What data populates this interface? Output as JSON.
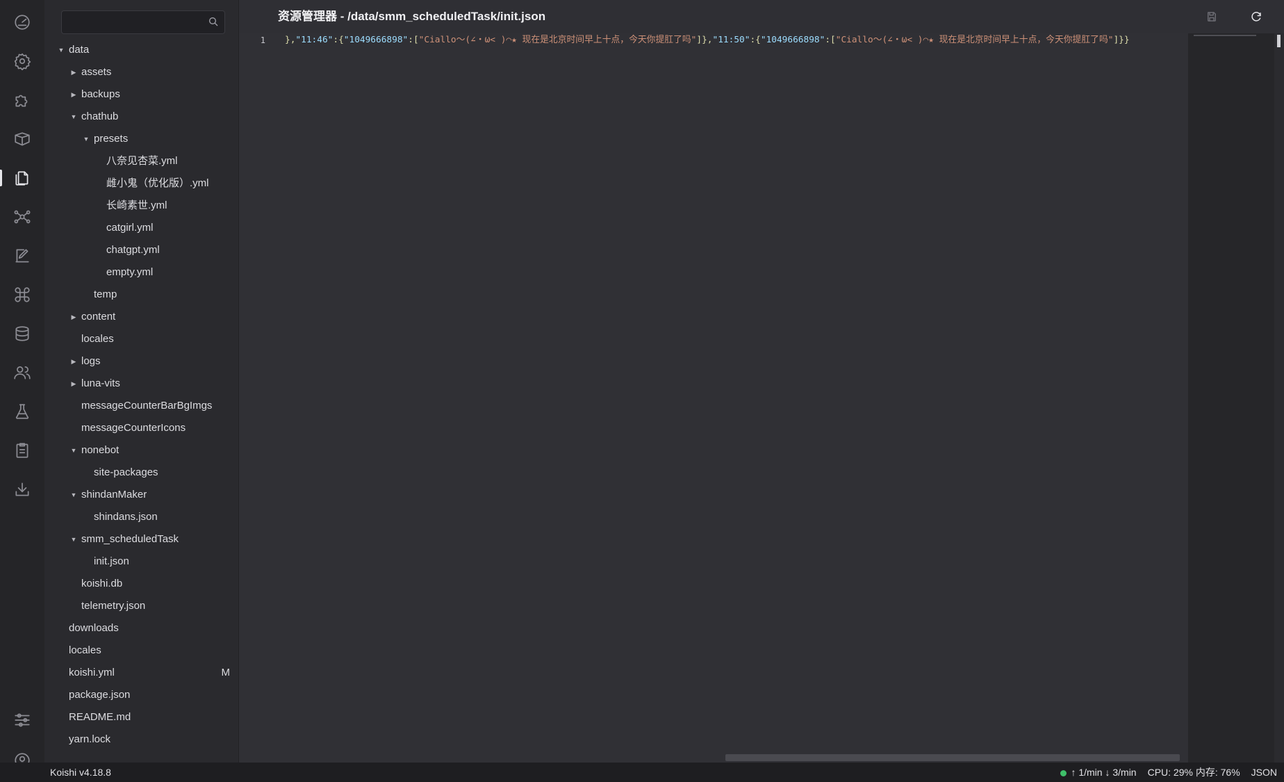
{
  "app": {
    "version": "Koishi v4.18.8"
  },
  "activity_bar": {
    "items": [
      {
        "name": "dashboard-icon"
      },
      {
        "name": "settings-icon"
      },
      {
        "name": "plugin-icon"
      },
      {
        "name": "market-icon"
      },
      {
        "name": "files-icon",
        "active": true
      },
      {
        "name": "graph-icon"
      },
      {
        "name": "edit-icon"
      },
      {
        "name": "command-icon"
      },
      {
        "name": "database-icon"
      },
      {
        "name": "users-icon"
      },
      {
        "name": "sandbox-icon"
      },
      {
        "name": "logs-icon"
      },
      {
        "name": "download-icon"
      },
      {
        "name": "sliders-icon"
      },
      {
        "name": "account-icon"
      }
    ]
  },
  "sidebar": {
    "search": {
      "placeholder": "",
      "value": ""
    },
    "tree": [
      {
        "label": "data",
        "depth": 0,
        "expanded": true,
        "folder": true
      },
      {
        "label": "assets",
        "depth": 1,
        "expanded": false,
        "folder": true
      },
      {
        "label": "backups",
        "depth": 1,
        "expanded": false,
        "folder": true
      },
      {
        "label": "chathub",
        "depth": 1,
        "expanded": true,
        "folder": true
      },
      {
        "label": "presets",
        "depth": 2,
        "expanded": true,
        "folder": true
      },
      {
        "label": "八奈见杏菜.yml",
        "depth": 3
      },
      {
        "label": "雌小鬼（优化版）.yml",
        "depth": 3
      },
      {
        "label": "长崎素世.yml",
        "depth": 3
      },
      {
        "label": "catgirl.yml",
        "depth": 3
      },
      {
        "label": "chatgpt.yml",
        "depth": 3
      },
      {
        "label": "empty.yml",
        "depth": 3
      },
      {
        "label": "temp",
        "depth": 2
      },
      {
        "label": "content",
        "depth": 1,
        "expanded": false,
        "folder": true
      },
      {
        "label": "locales",
        "depth": 1
      },
      {
        "label": "logs",
        "depth": 1,
        "expanded": false,
        "folder": true
      },
      {
        "label": "luna-vits",
        "depth": 1,
        "expanded": false,
        "folder": true
      },
      {
        "label": "messageCounterBarBgImgs",
        "depth": 1
      },
      {
        "label": "messageCounterIcons",
        "depth": 1
      },
      {
        "label": "nonebot",
        "depth": 1,
        "expanded": true,
        "folder": true
      },
      {
        "label": "site-packages",
        "depth": 2
      },
      {
        "label": "shindanMaker",
        "depth": 1,
        "expanded": true,
        "folder": true
      },
      {
        "label": "shindans.json",
        "depth": 2
      },
      {
        "label": "smm_scheduledTask",
        "depth": 1,
        "expanded": true,
        "folder": true
      },
      {
        "label": "init.json",
        "depth": 2
      },
      {
        "label": "koishi.db",
        "depth": 1
      },
      {
        "label": "telemetry.json",
        "depth": 1
      },
      {
        "label": "downloads",
        "depth": 0
      },
      {
        "label": "locales",
        "depth": 0
      },
      {
        "label": "koishi.yml",
        "depth": 0,
        "badge": "M"
      },
      {
        "label": "package.json",
        "depth": 0
      },
      {
        "label": "README.md",
        "depth": 0
      },
      {
        "label": "yarn.lock",
        "depth": 0
      }
    ]
  },
  "header": {
    "title": "资源管理器 - /data/smm_scheduledTask/init.json",
    "save_icon": "save-icon",
    "refresh_icon": "refresh-icon"
  },
  "editor": {
    "line_number": "1",
    "code": {
      "p1": "},",
      "k1": "\"11:46\"",
      "p2": ":{",
      "k2": "\"1049666898\"",
      "p3": ":[",
      "s1": "\"Ciallo～(∠・ω< )⌒★ 现在是北京时间早上十点，今天你提肛了吗\"",
      "p4": "]},",
      "k3": "\"11:50\"",
      "p5": ":{",
      "k4": "\"1049666898\"",
      "p6": ":[",
      "s2": "\"Ciallo～(∠・ω< )⌒★ 现在是北京时间早上十点，今天你提肛了吗\"",
      "p7": "]}}"
    }
  },
  "statusbar": {
    "version": "Koishi v4.18.8",
    "traffic": "↑ 1/min ↓ 3/min",
    "resources": "CPU: 29% 内存: 76%",
    "language": "JSON",
    "status_color": "#3fbf6a"
  }
}
